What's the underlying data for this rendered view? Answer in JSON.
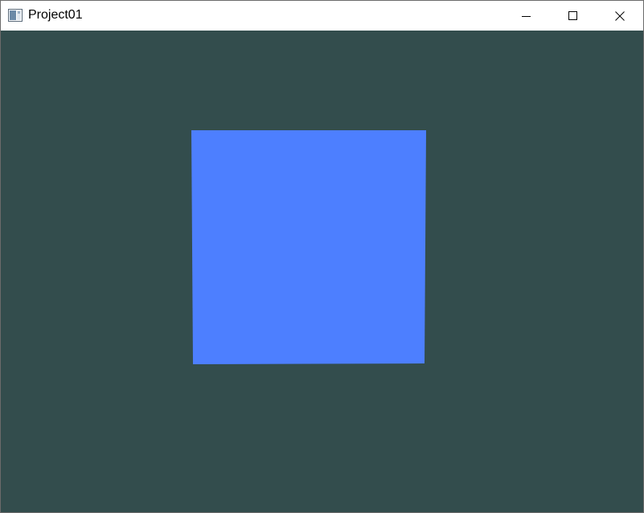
{
  "window": {
    "title": "Project01",
    "app_icon": "window-app-icon",
    "controls": {
      "minimize_icon": "minimize-icon",
      "maximize_icon": "maximize-icon",
      "close_icon": "close-icon"
    }
  },
  "canvas": {
    "clear_color": "#334d4d",
    "shape": {
      "kind": "quad",
      "fill_color": "#4d7fff"
    }
  }
}
